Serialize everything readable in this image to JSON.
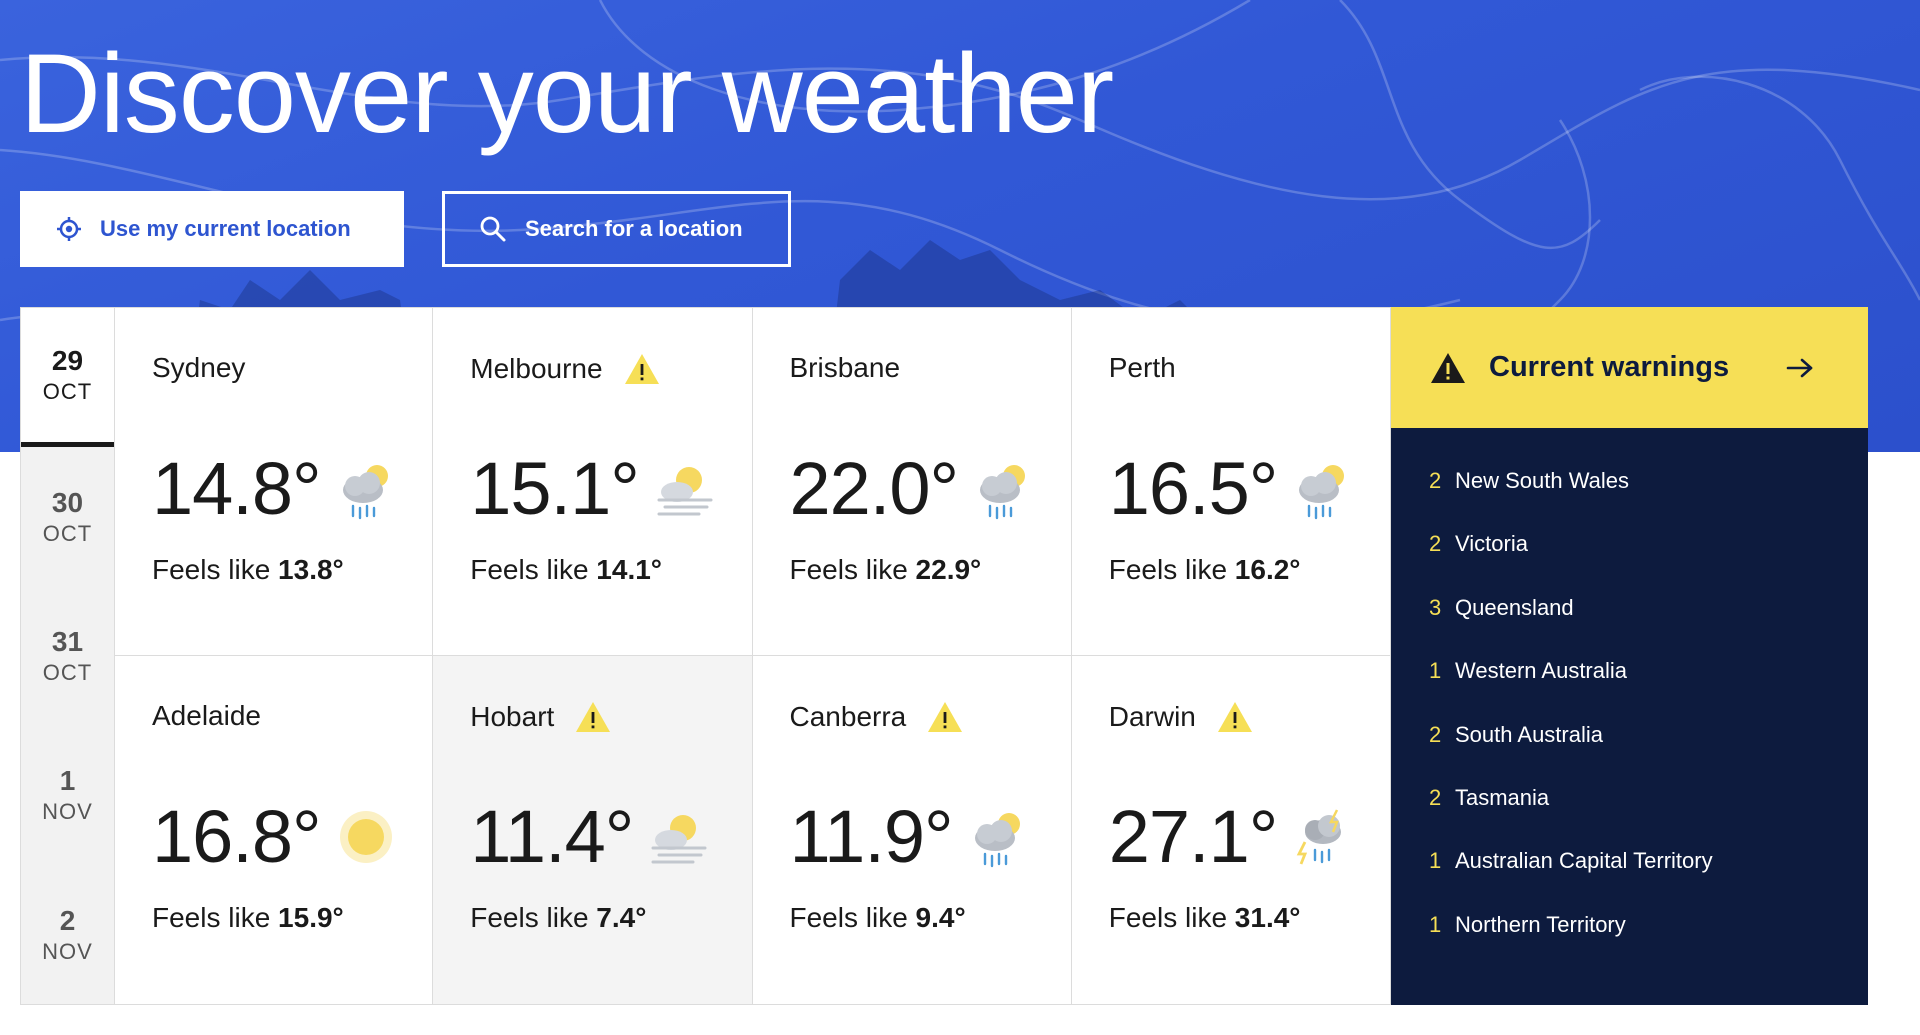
{
  "hero": {
    "title": "Discover your weather",
    "location_button": "Use my current location",
    "search_button": "Search for a location",
    "background_color": "#3158d6"
  },
  "dates": [
    {
      "day": "29",
      "month": "OCT",
      "active": true
    },
    {
      "day": "30",
      "month": "OCT"
    },
    {
      "day": "31",
      "month": "OCT"
    },
    {
      "day": "1",
      "month": "NOV"
    },
    {
      "day": "2",
      "month": "NOV"
    }
  ],
  "cities": [
    {
      "name": "Sydney",
      "temp": "14.8°",
      "feels_label": "Feels like",
      "feels": "13.8°",
      "icon": "rain-cloud-sun-icon",
      "warning": false
    },
    {
      "name": "Melbourne",
      "temp": "15.1°",
      "feels_label": "Feels like",
      "feels": "14.1°",
      "icon": "fog-sun-icon",
      "warning": true
    },
    {
      "name": "Brisbane",
      "temp": "22.0°",
      "feels_label": "Feels like",
      "feels": "22.9°",
      "icon": "rain-cloud-sun-icon",
      "warning": false
    },
    {
      "name": "Perth",
      "temp": "16.5°",
      "feels_label": "Feels like",
      "feels": "16.2°",
      "icon": "rain-cloud-sun-icon",
      "warning": false
    },
    {
      "name": "Adelaide",
      "temp": "16.8°",
      "feels_label": "Feels like",
      "feels": "15.9°",
      "icon": "sun-icon",
      "warning": false
    },
    {
      "name": "Hobart",
      "temp": "11.4°",
      "feels_label": "Feels like",
      "feels": "7.4°",
      "icon": "fog-sun-icon",
      "warning": true
    },
    {
      "name": "Canberra",
      "temp": "11.9°",
      "feels_label": "Feels like",
      "feels": "9.4°",
      "icon": "rain-cloud-sun-icon",
      "warning": true
    },
    {
      "name": "Darwin",
      "temp": "27.1°",
      "feels_label": "Feels like",
      "feels": "31.4°",
      "icon": "thunderstorm-icon",
      "warning": true
    }
  ],
  "warnings": {
    "title": "Current warnings",
    "accent_color": "#f6df56",
    "panel_color": "#0d1b3e",
    "items": [
      {
        "count": "2",
        "region": "New South Wales"
      },
      {
        "count": "2",
        "region": "Victoria"
      },
      {
        "count": "3",
        "region": "Queensland"
      },
      {
        "count": "1",
        "region": "Western Australia"
      },
      {
        "count": "2",
        "region": "South Australia"
      },
      {
        "count": "2",
        "region": "Tasmania"
      },
      {
        "count": "1",
        "region": "Australian Capital Territory"
      },
      {
        "count": "1",
        "region": "Northern Territory"
      }
    ]
  }
}
